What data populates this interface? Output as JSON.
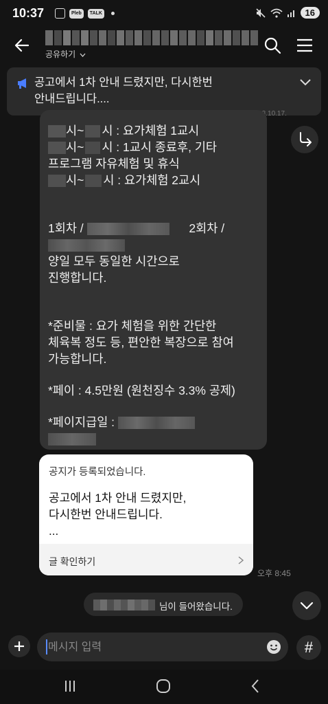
{
  "status_bar": {
    "time": "10:37",
    "battery": "16",
    "pill_label": "TALK",
    "badge_label": "Pleb"
  },
  "header": {
    "share_label": "공유하기"
  },
  "notice_banner": {
    "line1": "공고에서 1차 안내 드렸지만, 다시한번",
    "line2": "안내드립니다...."
  },
  "message": {
    "lines": [
      "시~",
      "시 : 요가체험 1교시",
      "시~",
      "시 : 1교시 종료후, 기타",
      "프로그램 자유체험 및 휴식",
      "시~",
      "시 : 요가체험 2교시",
      "1회차 /",
      "2회차 /",
      "양일 모두 동일한 시간으로",
      "진행합니다.",
      "*준비물 : 요가 체험을 위한 간단한",
      "체육복 정도 등, 편안한 복장으로 참여",
      "가능합니다.",
      "*페이 : 4.5만원 (원천징수 3.3% 공제)",
      "*페이지급일 :"
    ]
  },
  "notice_card": {
    "header": "공지가 등록되었습니다.",
    "body_line1": "공고에서 1차 안내 드렸지만,",
    "body_line2": "다시한번 안내드립니다.",
    "body_line3": "...",
    "footer_label": "글 확인하기",
    "time": "오후 8:45"
  },
  "join_notice": {
    "suffix": "님이 들어왔습니다."
  },
  "input": {
    "placeholder": "메시지 입력",
    "hash": "#"
  },
  "colors": {
    "background": "#141414",
    "bubble": "#333333",
    "card": "#ffffff",
    "accent": "#4a7dff"
  }
}
